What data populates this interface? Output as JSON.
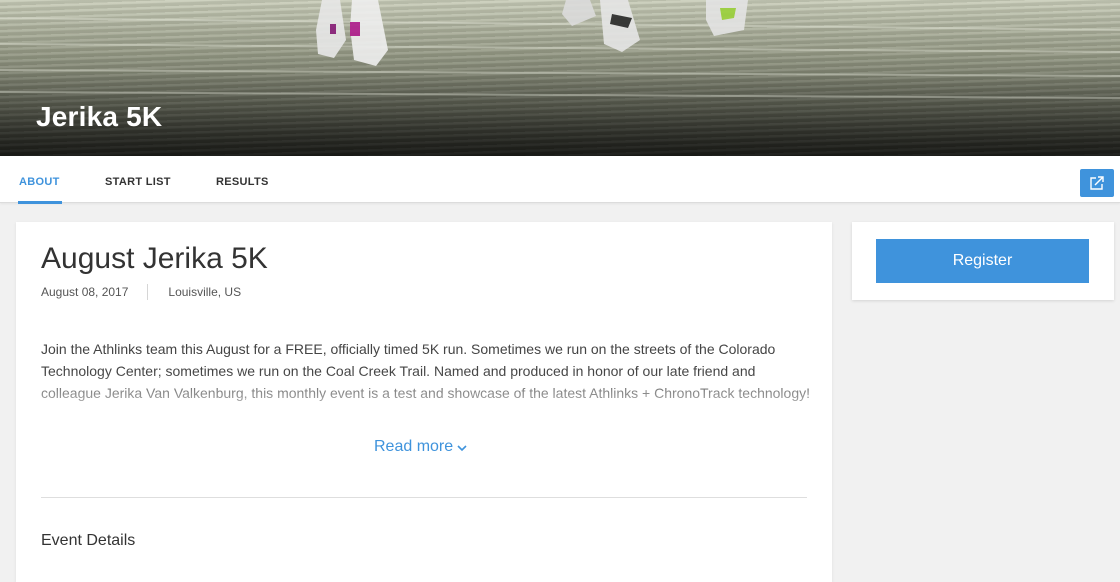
{
  "hero": {
    "title": "Jerika 5K"
  },
  "tabs": [
    {
      "label": "ABOUT",
      "active": true
    },
    {
      "label": "START LIST",
      "active": false
    },
    {
      "label": "RESULTS",
      "active": false
    }
  ],
  "share": {
    "icon": "share-icon"
  },
  "event": {
    "title": "August Jerika 5K",
    "date": "August 08, 2017",
    "location": "Louisville, US",
    "description": "Join the Athlinks team this August for a FREE, officially timed 5K run. Sometimes we run on the streets of the Colorado Technology Center; sometimes we run on the Coal Creek Trail. Named and produced in honor of our late friend and colleague Jerika Van Valkenburg, this monthly event is a test and showcase of the latest Athlinks + ChronoTrack technology!",
    "read_more_label": "Read more",
    "details_heading": "Event Details"
  },
  "sidebar": {
    "register_label": "Register"
  },
  "colors": {
    "accent": "#3f93dc",
    "text": "#333333",
    "background": "#f1f1f1"
  }
}
